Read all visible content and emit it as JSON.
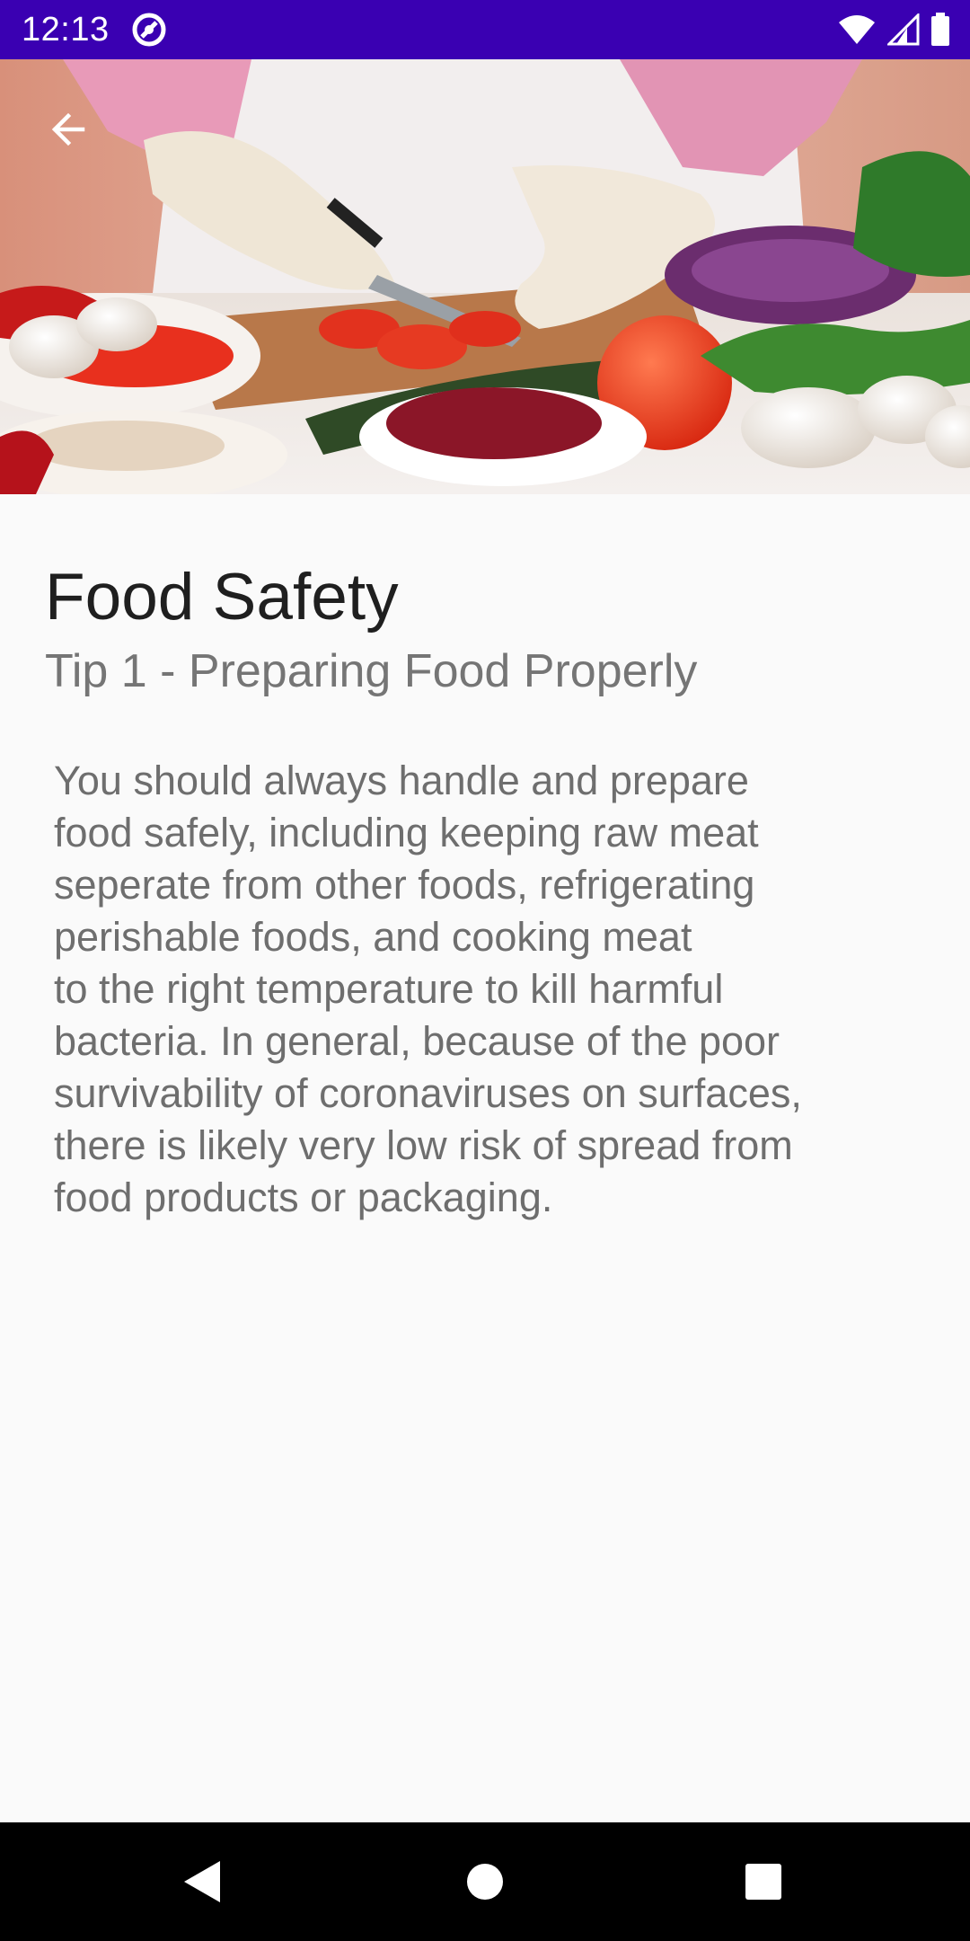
{
  "status_bar": {
    "time": "12:13",
    "background_color": "#3a00b2",
    "icons": [
      "app-notification-icon",
      "wifi-icon",
      "signal-icon",
      "battery-icon"
    ]
  },
  "hero": {
    "image_description_icon": "food-preparation-image",
    "back_icon": "arrow-left-icon"
  },
  "content": {
    "title": "Food Safety",
    "subtitle": "Tip 1 - Preparing Food Properly",
    "body_lines": [
      "You should always handle and prepare",
      "food safely, including keeping raw meat",
      "seperate from other foods, refrigerating",
      "perishable foods, and cooking meat",
      "to the right temperature to kill harmful",
      "bacteria. In general, because of the poor",
      "survivability of coronaviruses on surfaces,",
      "there is likely very low risk of spread from",
      "food products or packaging."
    ]
  },
  "nav_bar": {
    "buttons": [
      "back-triangle-icon",
      "home-circle-icon",
      "recents-square-icon"
    ]
  }
}
